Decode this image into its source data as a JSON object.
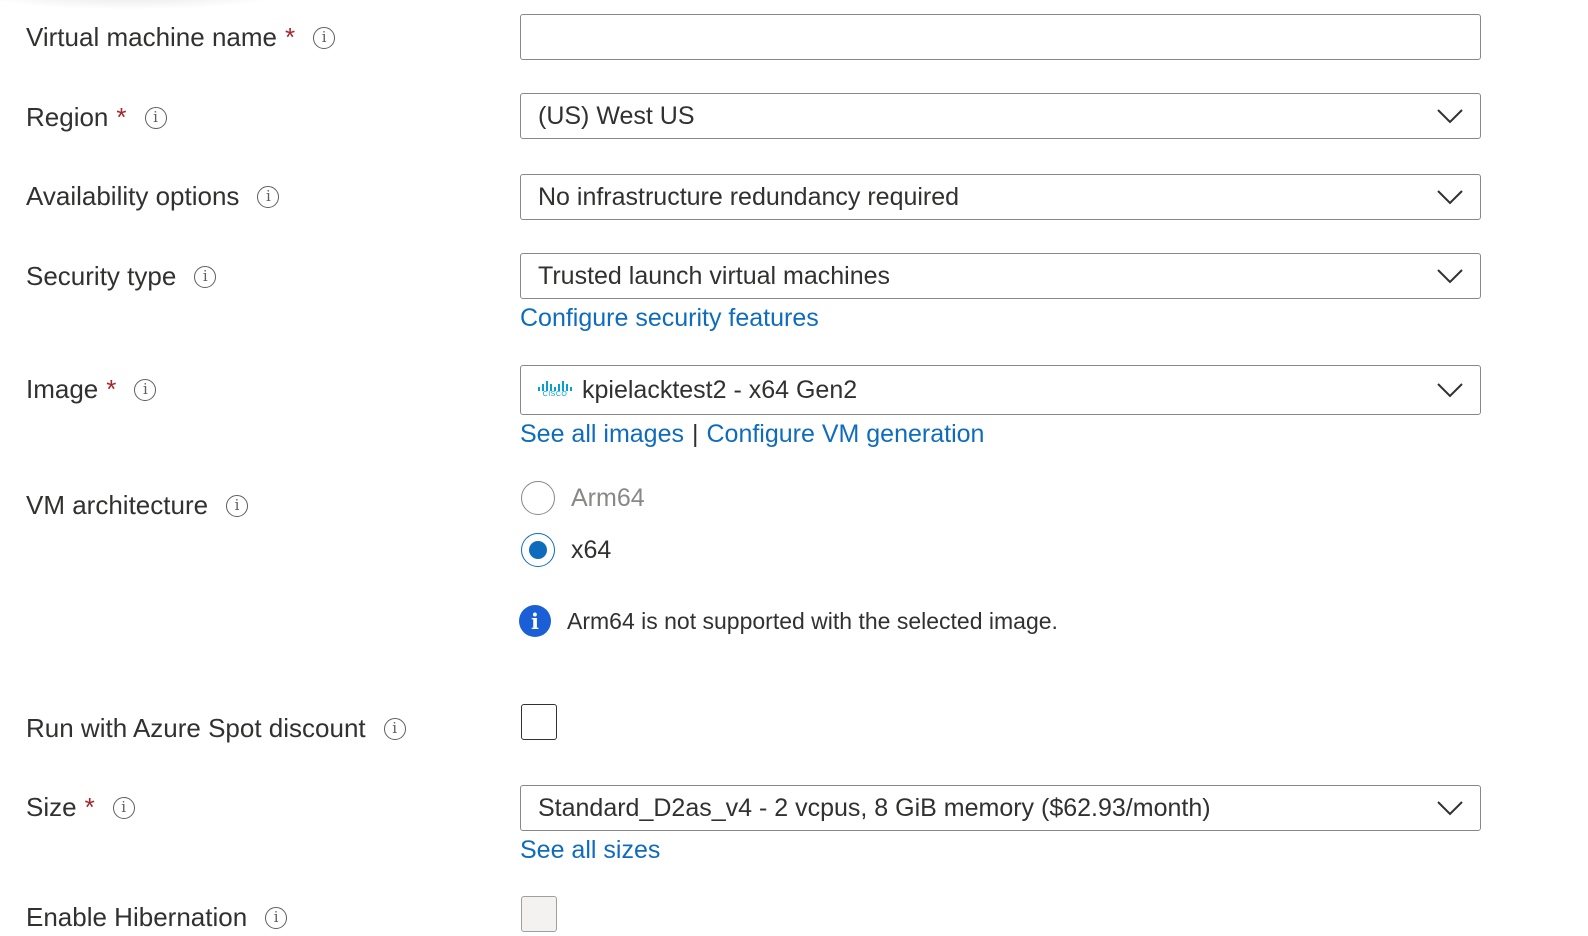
{
  "fields": {
    "vm_name": {
      "label": "Virtual machine name",
      "required_mark": "*",
      "value": "",
      "placeholder": ""
    },
    "region": {
      "label": "Region",
      "required_mark": "*",
      "value": "(US) West US"
    },
    "availability": {
      "label": "Availability options",
      "value": "No infrastructure redundancy required"
    },
    "security_type": {
      "label": "Security type",
      "value": "Trusted launch virtual machines",
      "link": "Configure security features"
    },
    "image": {
      "label": "Image",
      "required_mark": "*",
      "value": "kpielacktest2 - x64 Gen2",
      "publisher_logo_text": "CISCO",
      "link_all": "See all images",
      "separator": "|",
      "link_config": "Configure VM generation"
    },
    "vm_architecture": {
      "label": "VM architecture",
      "options": [
        {
          "label": "Arm64",
          "selected": false,
          "disabled": true
        },
        {
          "label": "x64",
          "selected": true,
          "disabled": false
        }
      ],
      "notice": "Arm64 is not supported with the selected image."
    },
    "spot": {
      "label": "Run with Azure Spot discount",
      "checked": false
    },
    "size": {
      "label": "Size",
      "required_mark": "*",
      "value": "Standard_D2as_v4 - 2 vcpus, 8 GiB memory ($62.93/month)",
      "link": "See all sizes"
    },
    "hibernation": {
      "label": "Enable Hibernation",
      "checked": false,
      "disabled": true
    }
  },
  "icons": {
    "info": "info-icon",
    "chevron": "chevron-down-icon",
    "notice": "info-filled-icon"
  },
  "colors": {
    "link": "#0f6cbd",
    "required": "#a4262c",
    "notice_icon": "#1a5fd6",
    "cisco_logo": "#049fd9"
  }
}
